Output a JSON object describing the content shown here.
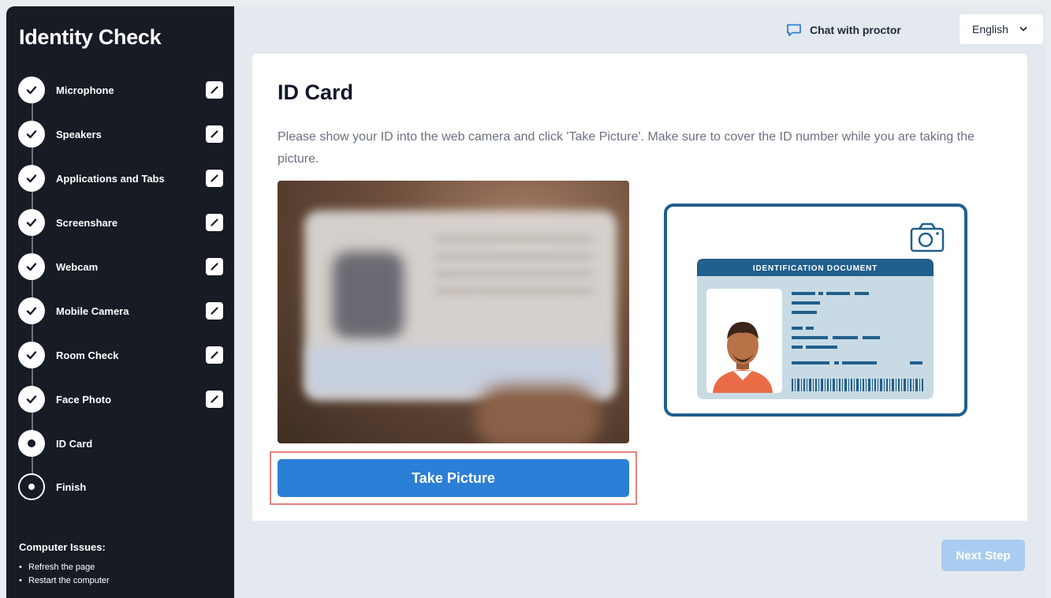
{
  "sidebar": {
    "title": "Identity Check",
    "steps": [
      {
        "label": "Microphone",
        "status": "done"
      },
      {
        "label": "Speakers",
        "status": "done"
      },
      {
        "label": "Applications and Tabs",
        "status": "done"
      },
      {
        "label": "Screenshare",
        "status": "done"
      },
      {
        "label": "Webcam",
        "status": "done"
      },
      {
        "label": "Mobile Camera",
        "status": "done"
      },
      {
        "label": "Room Check",
        "status": "done"
      },
      {
        "label": "Face Photo",
        "status": "done"
      },
      {
        "label": "ID Card",
        "status": "current"
      },
      {
        "label": "Finish",
        "status": "pending"
      }
    ],
    "issues": {
      "heading": "Computer Issues:",
      "items": [
        "Refresh the page",
        "Restart the computer"
      ]
    }
  },
  "topbar": {
    "chat_label": "Chat with proctor",
    "language": "English"
  },
  "main": {
    "title": "ID Card",
    "description": "Please show your ID into the web camera and click 'Take Picture'. Make sure to cover the ID number while you are taking the picture.",
    "take_picture_label": "Take Picture",
    "illustration_header": "IDENTIFICATION DOCUMENT"
  },
  "footer": {
    "next_label": "Next Step"
  },
  "colors": {
    "sidebar_bg": "#161b24",
    "primary": "#2c7fd6",
    "primary_disabled": "#a9cdf1",
    "highlight": "#e8827c",
    "id_blue": "#215f8c"
  },
  "icons": {
    "done_step": "check-circle-icon",
    "step_done_marker": "pencil-icon",
    "chat": "chat-bubble-icon",
    "language": "chevron-down-icon",
    "camera": "camera-icon"
  }
}
